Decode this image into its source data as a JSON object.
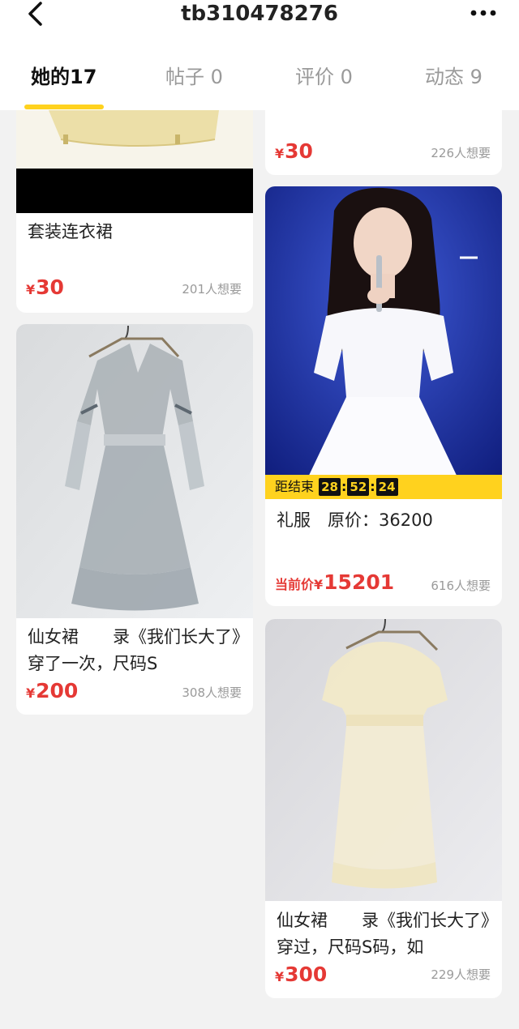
{
  "header": {
    "title": "tb310478276",
    "back_icon": "chevron-left-icon",
    "more_icon": "more-dots-icon"
  },
  "tabs": [
    {
      "label": "她的17",
      "active": true
    },
    {
      "label": "帖子 0",
      "active": false
    },
    {
      "label": "评价 0",
      "active": false
    },
    {
      "label": "动态 9",
      "active": false
    }
  ],
  "colors": {
    "accent": "#ffd21e",
    "price": "#e53935"
  },
  "listings": [
    {
      "title": "套装连衣裙",
      "currency": "¥",
      "price": "30",
      "wants": "201人想要"
    },
    {
      "title": "仙女裙　　录《我们长大了》穿了一次，尺码S",
      "currency": "¥",
      "price": "200",
      "wants": "308人想要"
    },
    {
      "title": "",
      "currency": "¥",
      "price": "30",
      "wants": "226人想要"
    },
    {
      "title": "礼服　原价：36200",
      "price_prefix": "当前价",
      "currency": "¥",
      "price": "15201",
      "wants": "616人想要",
      "countdown": {
        "label": "距结束",
        "h": "28",
        "m": "52",
        "s": "24"
      }
    },
    {
      "title": "仙女裙　　录《我们长大了》穿过，尺码S码，如",
      "currency": "¥",
      "price": "300",
      "wants": "229人想要"
    }
  ]
}
